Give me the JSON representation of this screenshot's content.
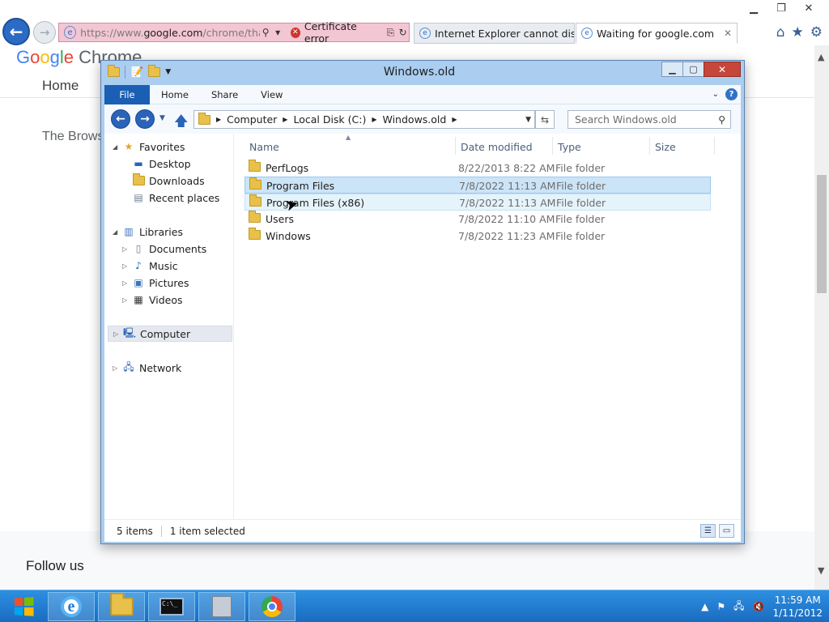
{
  "browser": {
    "address_url_prefix": "https://www.",
    "address_url_domain": "google.com",
    "address_url_suffix": "/chrome/thank-yo",
    "certificate_label": "Certificate error",
    "tabs": [
      {
        "label": "Internet Explorer cannot displa..."
      },
      {
        "label": "Waiting for google.com"
      }
    ]
  },
  "webpage": {
    "logo_google": [
      "G",
      "o",
      "o",
      "g",
      "l",
      "e"
    ],
    "logo_product": "Chrome",
    "nav_home": "Home",
    "heading_partial": "The Brows",
    "footer_follow": "Follow us"
  },
  "explorer": {
    "title": "Windows.old",
    "ribbon_tabs": [
      "File",
      "Home",
      "Share",
      "View"
    ],
    "breadcrumb": [
      "Computer",
      "Local Disk (C:)",
      "Windows.old"
    ],
    "search_placeholder": "Search Windows.old",
    "nav_pane": {
      "favorites": "Favorites",
      "favorites_items": [
        "Desktop",
        "Downloads",
        "Recent places"
      ],
      "libraries": "Libraries",
      "libraries_items": [
        "Documents",
        "Music",
        "Pictures",
        "Videos"
      ],
      "computer": "Computer",
      "network": "Network"
    },
    "columns": [
      "Name",
      "Date modified",
      "Type",
      "Size"
    ],
    "files": [
      {
        "name": "PerfLogs",
        "date": "8/22/2013 8:22 AM",
        "type": "File folder"
      },
      {
        "name": "Program Files",
        "date": "7/8/2022 11:13 AM",
        "type": "File folder"
      },
      {
        "name": "Program Files (x86)",
        "date": "7/8/2022 11:13 AM",
        "type": "File folder"
      },
      {
        "name": "Users",
        "date": "7/8/2022 11:10 AM",
        "type": "File folder"
      },
      {
        "name": "Windows",
        "date": "7/8/2022 11:23 AM",
        "type": "File folder"
      }
    ],
    "status_items": "5 items",
    "status_selected": "1 item selected"
  },
  "taskbar": {
    "time": "11:59 AM",
    "date": "1/11/2012"
  },
  "icons": {
    "back": "back-arrow-icon",
    "forward": "forward-arrow-icon",
    "folder": "folder-icon",
    "search": "search-icon",
    "help": "help-icon"
  },
  "colors": {
    "accent": "#1a5fb4",
    "selection": "#cce4f7",
    "certificate_error": "#f3c6d3",
    "taskbar": "#1a6cc0"
  }
}
